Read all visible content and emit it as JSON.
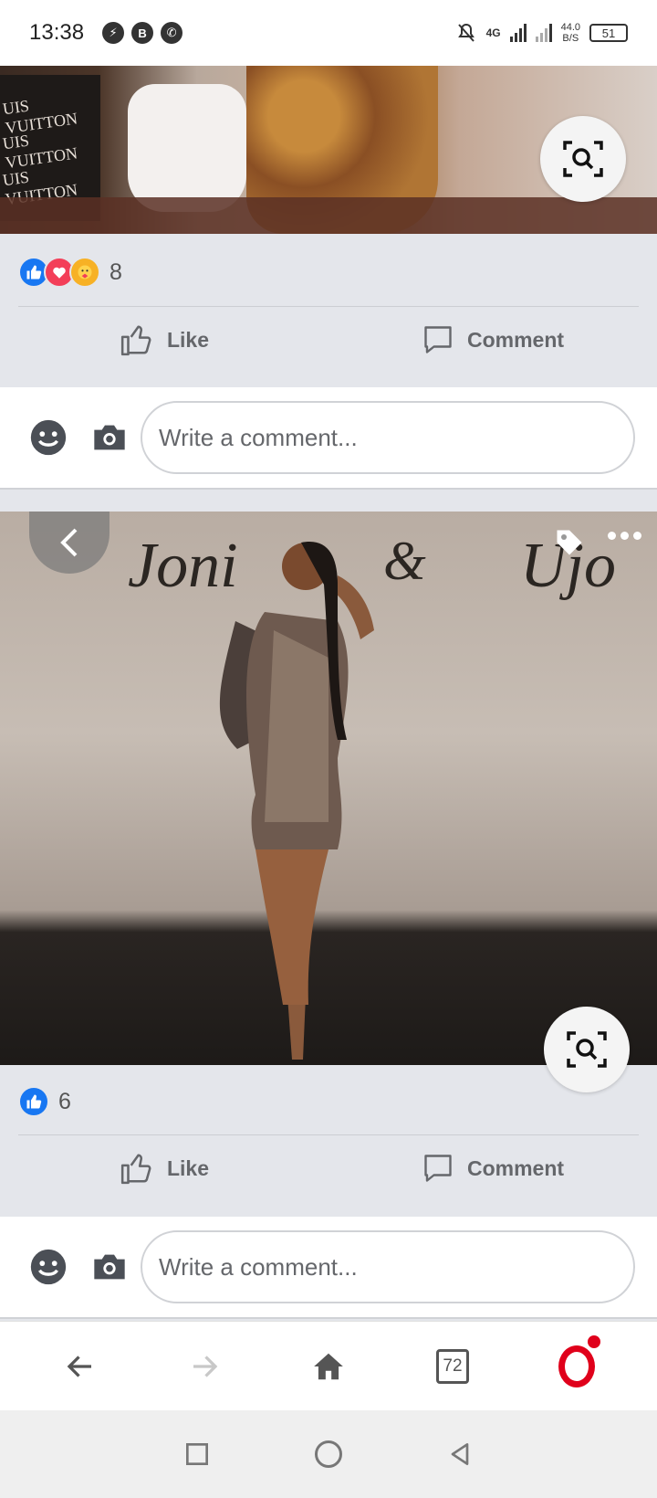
{
  "status_bar": {
    "time": "13:38",
    "network": "4G",
    "speed_value": "44.0",
    "speed_unit": "B/S",
    "battery": "51"
  },
  "post1": {
    "box_texts": [
      "UIS VUITTON",
      "UIS VUITTON",
      "UIS VUITTON"
    ],
    "reactions": [
      "like-reaction-icon",
      "love-reaction-icon",
      "care-reaction-icon"
    ],
    "reaction_count": "8",
    "like_label": "Like",
    "comment_label": "Comment",
    "comment_placeholder": "Write a comment..."
  },
  "post2": {
    "reactions": [
      "like-reaction-icon"
    ],
    "reaction_count": "6",
    "like_label": "Like",
    "comment_label": "Comment",
    "comment_placeholder": "Write a comment..."
  },
  "browser": {
    "tabs_count": "72"
  },
  "colors": {
    "accent_blue": "#1877f2",
    "love_red": "#f33e58",
    "care_yellow": "#f7b125",
    "opera_red": "#e0001b",
    "feed_gray": "#e4e6eb"
  }
}
